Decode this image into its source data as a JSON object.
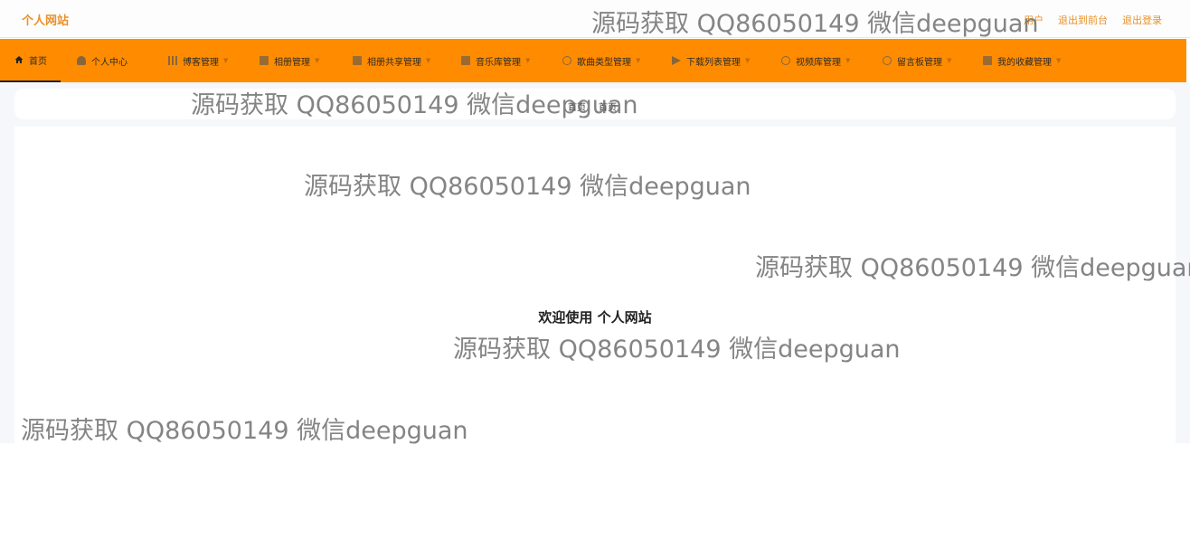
{
  "header": {
    "site_title": "个人网站",
    "links": [
      "用户",
      "退出到前台",
      "退出登录"
    ]
  },
  "nav": {
    "items": [
      {
        "label": "首页",
        "icon": "home-icon"
      },
      {
        "label": "个人中心",
        "icon": "person-icon"
      },
      {
        "label": "博客管理",
        "icon": "bar-chart-icon"
      },
      {
        "label": "相册管理",
        "icon": "camera-icon"
      },
      {
        "label": "相册共享管理",
        "icon": "grid-icon"
      },
      {
        "label": "音乐库管理",
        "icon": "music-icon"
      },
      {
        "label": "歌曲类型管理",
        "icon": "clock-icon"
      },
      {
        "label": "下载列表管理",
        "icon": "send-icon"
      },
      {
        "label": "视频库管理",
        "icon": "circle-icon"
      },
      {
        "label": "留言板管理",
        "icon": "power-icon"
      },
      {
        "label": "我的收藏管理",
        "icon": "bookmark-icon"
      }
    ]
  },
  "breadcrumb": [
    "首页",
    "首页"
  ],
  "welcome_text": "欢迎使用 个人网站",
  "watermark_text": "源码获取 QQ86050149 微信deepguan",
  "colors": {
    "accent": "#ff8c00",
    "title": "#e8912a"
  }
}
